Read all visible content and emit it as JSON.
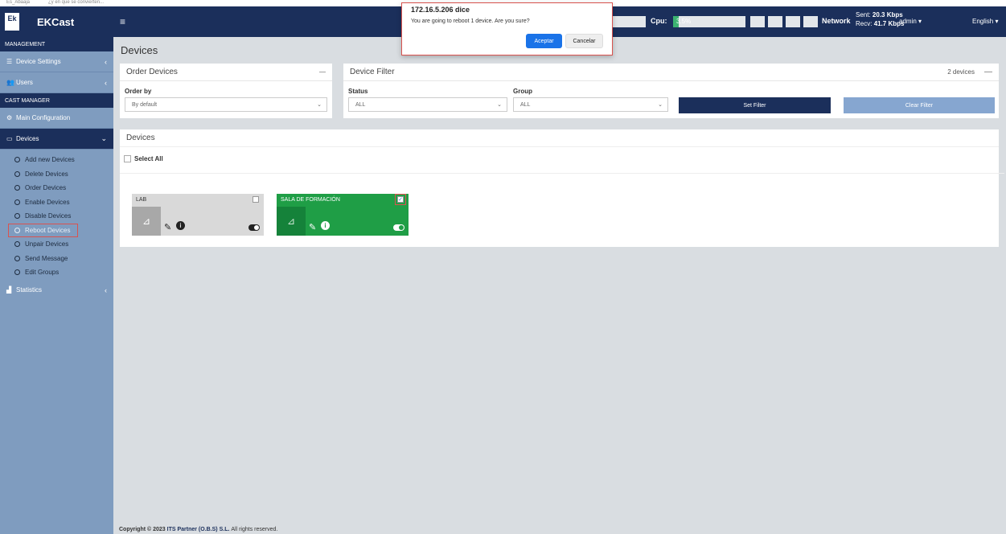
{
  "browser": {
    "bookmarks": [
      "Es_Abaaja",
      "¿y en que se convierten..."
    ]
  },
  "brand": {
    "logo": "Ek",
    "name": "EKCast"
  },
  "sidebar": {
    "management_header": "MANAGEMENT",
    "device_settings": "Device Settings",
    "users": "Users",
    "cast_manager_header": "CAST MANAGER",
    "main_configuration": "Main Configuration",
    "devices": "Devices",
    "sub_items": [
      "Add new Devices",
      "Delete Devices",
      "Order Devices",
      "Enable Devices",
      "Disable Devices",
      "Reboot Devices",
      "Unpair Devices",
      "Send Message",
      "Edit Groups"
    ],
    "statistics": "Statistics"
  },
  "topbar": {
    "menu_icon": "≡",
    "cpu_label": "Cpu:",
    "cpu_value": "3.5%",
    "cpu_fraction": 0.035,
    "network_label": "Network",
    "sent_label": "Sent:",
    "sent_value": "20.3 Kbps",
    "recv_label": "Recv:",
    "recv_value": "41.7 Kbps",
    "user": "admin ▾",
    "language": "English ▾"
  },
  "page": {
    "title": "Devices"
  },
  "order_panel": {
    "title": "Order Devices",
    "collapse": "—",
    "order_by_label": "Order by",
    "order_by_value": "By default"
  },
  "filter_panel": {
    "title": "Device Filter",
    "count": "2 devices",
    "collapse": "—",
    "status_label": "Status",
    "status_value": "ALL",
    "group_label": "Group",
    "group_value": "ALL",
    "set_filter": "Set Filter",
    "clear_filter": "Clear Filter"
  },
  "devices_panel": {
    "title": "Devices",
    "select_all": "Select All",
    "cards": [
      {
        "name": "LAB",
        "checked": false,
        "color": "#d9d9d9"
      },
      {
        "name": "SALA DE FORMACIÓN",
        "checked": true,
        "color": "#1f9e46"
      }
    ]
  },
  "footer": {
    "copyright": "Copyright © 2023",
    "company": "ITS Partner (O.B.S) S.L.",
    "rights": "All rights reserved."
  },
  "dialog": {
    "title": "172.16.5.206 dice",
    "message": "You are going to reboot 1 device. Are you sure?",
    "accept": "Aceptar",
    "cancel": "Cancelar"
  }
}
